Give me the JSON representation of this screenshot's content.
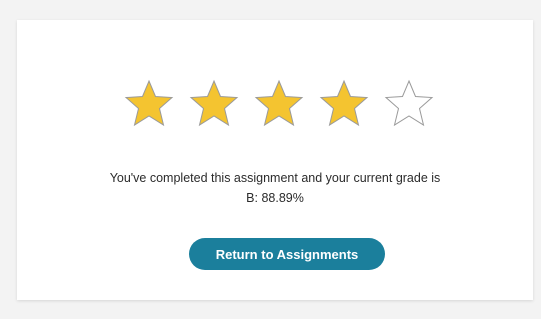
{
  "rating": {
    "filled": 4,
    "total": 5,
    "filled_color": "#F4C430",
    "empty_color": "#FFFFFF",
    "stroke_color": "#9A9A9A"
  },
  "message": {
    "line1": "You've completed this assignment and your current grade is",
    "line2": "B: 88.89%"
  },
  "actions": {
    "return_label": "Return to Assignments"
  },
  "colors": {
    "button": "#1B7F9C",
    "background": "#F3F3F3",
    "card": "#FFFFFF"
  }
}
